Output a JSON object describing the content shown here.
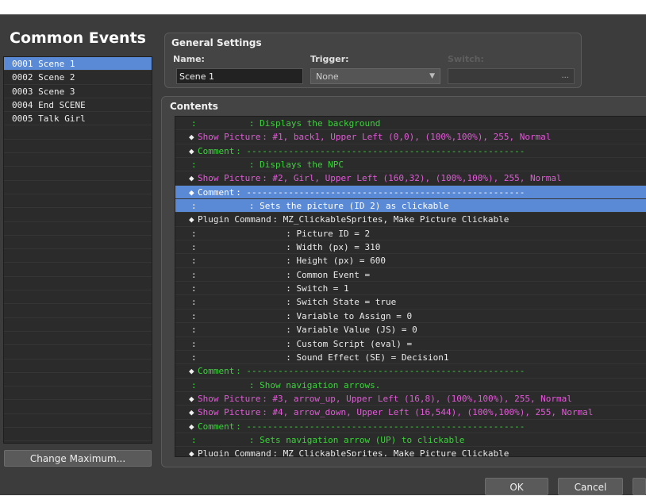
{
  "left_panel": {
    "title": "Common Events",
    "events": [
      {
        "id": "0001",
        "name": "Scene 1",
        "selected": true
      },
      {
        "id": "0002",
        "name": "Scene 2"
      },
      {
        "id": "0003",
        "name": "Scene 3"
      },
      {
        "id": "0004",
        "name": "End SCENE"
      },
      {
        "id": "0005",
        "name": "Talk Girl"
      }
    ],
    "change_max_label": "Change Maximum..."
  },
  "general": {
    "title": "General Settings",
    "name_label": "Name:",
    "name_value": "Scene 1",
    "trigger_label": "Trigger:",
    "trigger_value": "None",
    "switch_label": "Switch:",
    "switch_dots": "..."
  },
  "contents": {
    "title": "Contents",
    "commands": [
      {
        "type": "cont",
        "name": "",
        "body": ":          : Displays the background",
        "color": "green"
      },
      {
        "type": "cmd",
        "name": "Show Picture",
        "body": ": #1, back1, Upper Left (0,0), (100%,100%), 255, Normal",
        "color": "pink"
      },
      {
        "type": "cmd",
        "name": "Comment",
        "body": ": -----------------------------------------------------",
        "color": "green"
      },
      {
        "type": "cont",
        "name": "",
        "body": ":          : Displays the NPC",
        "color": "green"
      },
      {
        "type": "cmd",
        "name": "Show Picture",
        "body": ": #2, Girl, Upper Left (160,32), (100%,100%), 255, Normal",
        "color": "pink"
      },
      {
        "type": "cmd",
        "name": "Comment",
        "body": ": -----------------------------------------------------",
        "color": "green",
        "selected": true
      },
      {
        "type": "cont",
        "name": "",
        "body": ":          : Sets the picture (ID 2) as clickable",
        "color": "green",
        "selected": true
      },
      {
        "type": "cmd",
        "name": "Plugin Command",
        "body": ": MZ_ClickableSprites, Make Picture Clickable",
        "color": "white"
      },
      {
        "type": "cont",
        "name": "",
        "body": ":                 : Picture ID = 2",
        "color": "white"
      },
      {
        "type": "cont",
        "name": "",
        "body": ":                 : Width (px) = 310",
        "color": "white"
      },
      {
        "type": "cont",
        "name": "",
        "body": ":                 : Height (px) = 600",
        "color": "white"
      },
      {
        "type": "cont",
        "name": "",
        "body": ":                 : Common Event =",
        "color": "white"
      },
      {
        "type": "cont",
        "name": "",
        "body": ":                 : Switch = 1",
        "color": "white"
      },
      {
        "type": "cont",
        "name": "",
        "body": ":                 : Switch State = true",
        "color": "white"
      },
      {
        "type": "cont",
        "name": "",
        "body": ":                 : Variable to Assign = 0",
        "color": "white"
      },
      {
        "type": "cont",
        "name": "",
        "body": ":                 : Variable Value (JS) = 0",
        "color": "white"
      },
      {
        "type": "cont",
        "name": "",
        "body": ":                 : Custom Script (eval) =",
        "color": "white"
      },
      {
        "type": "cont",
        "name": "",
        "body": ":                 : Sound Effect (SE) = Decision1",
        "color": "white"
      },
      {
        "type": "cmd",
        "name": "Comment",
        "body": ": -----------------------------------------------------",
        "color": "green"
      },
      {
        "type": "cont",
        "name": "",
        "body": ":          : Show navigation arrows.",
        "color": "green"
      },
      {
        "type": "cmd",
        "name": "Show Picture",
        "body": ": #3, arrow_up, Upper Left (16,8), (100%,100%), 255, Normal",
        "color": "pink"
      },
      {
        "type": "cmd",
        "name": "Show Picture",
        "body": ": #4, arrow_down, Upper Left (16,544), (100%,100%), 255, Normal",
        "color": "pink"
      },
      {
        "type": "cmd",
        "name": "Comment",
        "body": ": -----------------------------------------------------",
        "color": "green"
      },
      {
        "type": "cont",
        "name": "",
        "body": ":          : Sets navigation arrow (UP) to clickable",
        "color": "green"
      },
      {
        "type": "cmd",
        "name": "Plugin Command",
        "body": ": MZ_ClickableSprites, Make Picture Clickable",
        "color": "white"
      }
    ]
  },
  "buttons": {
    "ok": "OK",
    "cancel": "Cancel"
  },
  "colors": {
    "selection": "#5a8ad6",
    "pink": "#e25ad8",
    "green": "#3bd33b"
  }
}
